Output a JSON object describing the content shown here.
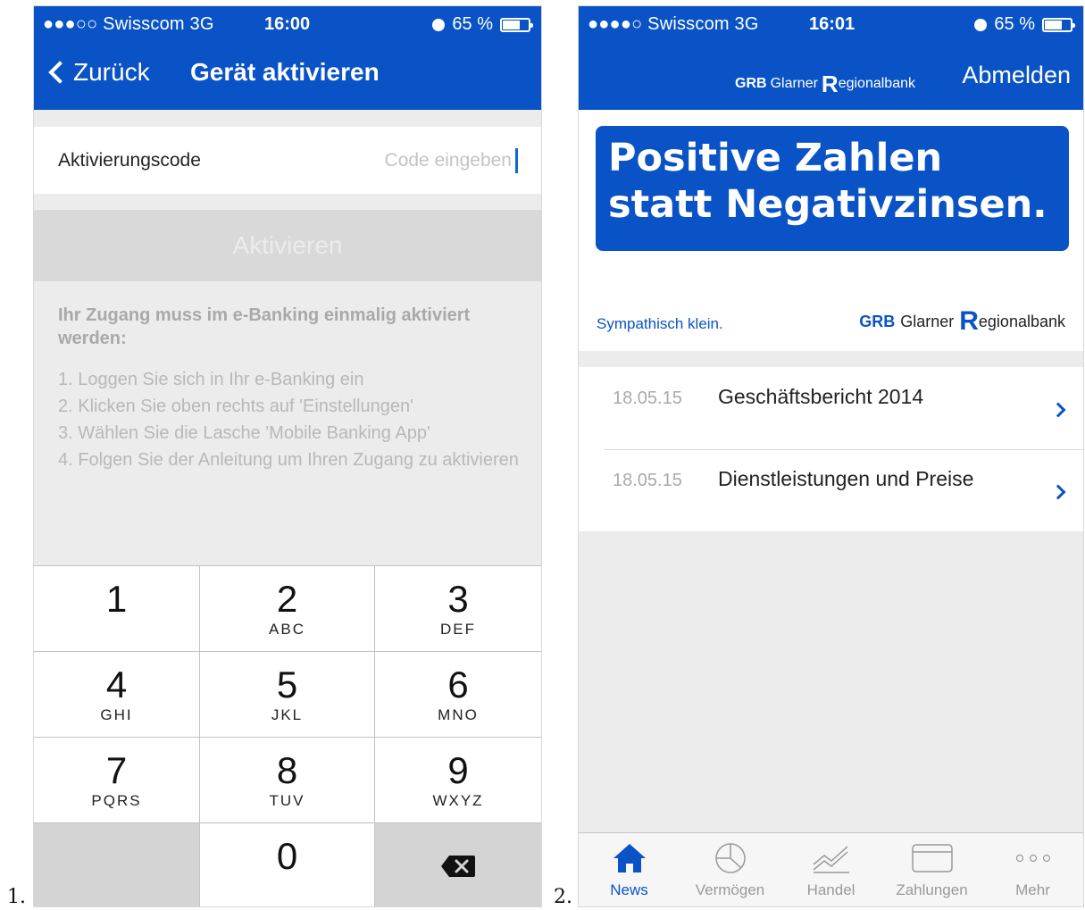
{
  "labels": {
    "one": "1.",
    "two": "2."
  },
  "screen1": {
    "status": {
      "carrier": "●●●○○ Swisscom  3G",
      "time": "16:00",
      "battery": "65 %"
    },
    "nav": {
      "back_label": "Zurück",
      "title": "Gerät aktivieren"
    },
    "field": {
      "label": "Aktivierungscode",
      "placeholder": "Code eingeben"
    },
    "activate_label": "Aktivieren",
    "info_heading": "Ihr Zugang muss im e-Banking einmalig aktiviert werden:",
    "steps": [
      "1. Loggen Sie sich in Ihr e-Banking ein",
      "2. Klicken Sie oben rechts auf 'Einstellungen'",
      "3. Wählen Sie die Lasche 'Mobile Banking App'",
      "4. Folgen Sie der Anleitung um Ihren Zugang zu aktivieren"
    ],
    "keypad": [
      {
        "digit": "1",
        "letters": ""
      },
      {
        "digit": "2",
        "letters": "ABC"
      },
      {
        "digit": "3",
        "letters": "DEF"
      },
      {
        "digit": "4",
        "letters": "GHI"
      },
      {
        "digit": "5",
        "letters": "JKL"
      },
      {
        "digit": "6",
        "letters": "MNO"
      },
      {
        "digit": "7",
        "letters": "PQRS"
      },
      {
        "digit": "8",
        "letters": "TUV"
      },
      {
        "digit": "9",
        "letters": "WXYZ"
      },
      {
        "digit": "0",
        "letters": ""
      }
    ]
  },
  "screen2": {
    "status": {
      "carrier": "●●●●○ Swisscom  3G",
      "time": "16:01",
      "battery": "65 %"
    },
    "brand_small": {
      "abbr": "GRB",
      "name1": "Glarner",
      "r": "R",
      "name2": "egionalbank"
    },
    "logout_label": "Abmelden",
    "banner": {
      "line1": "Positive Zahlen",
      "line2": "statt Negativzinsen."
    },
    "slogan": "Sympathisch klein.",
    "brand_big": {
      "abbr": "GRB",
      "name1": "Glarner",
      "r": "R",
      "name2": "egionalbank"
    },
    "news": [
      {
        "date": "18.05.15",
        "title": "Geschäftsbericht 2014"
      },
      {
        "date": "18.05.15",
        "title": "Dienstleistungen und Preise"
      }
    ],
    "tabs": [
      {
        "label": "News",
        "icon": "home-icon"
      },
      {
        "label": "Vermögen",
        "icon": "pie-chart-icon"
      },
      {
        "label": "Handel",
        "icon": "trend-chart-icon"
      },
      {
        "label": "Zahlungen",
        "icon": "credit-card-icon"
      },
      {
        "label": "Mehr",
        "icon": "more-dots-icon"
      }
    ]
  },
  "colors": {
    "brand_blue": "#0a53c6",
    "disabled_gray": "#d9d9d9",
    "background": "#ececec"
  }
}
